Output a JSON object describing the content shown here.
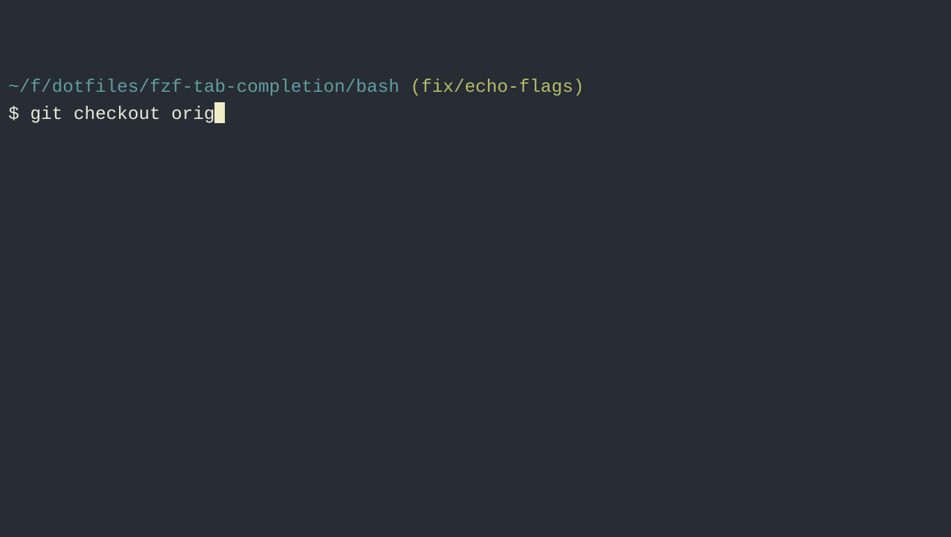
{
  "prompt": {
    "path": "~/f/dotfiles/fzf-tab-completion/bash",
    "branch": "(fix/echo-flags)",
    "symbol": "$",
    "command": "git checkout orig"
  }
}
